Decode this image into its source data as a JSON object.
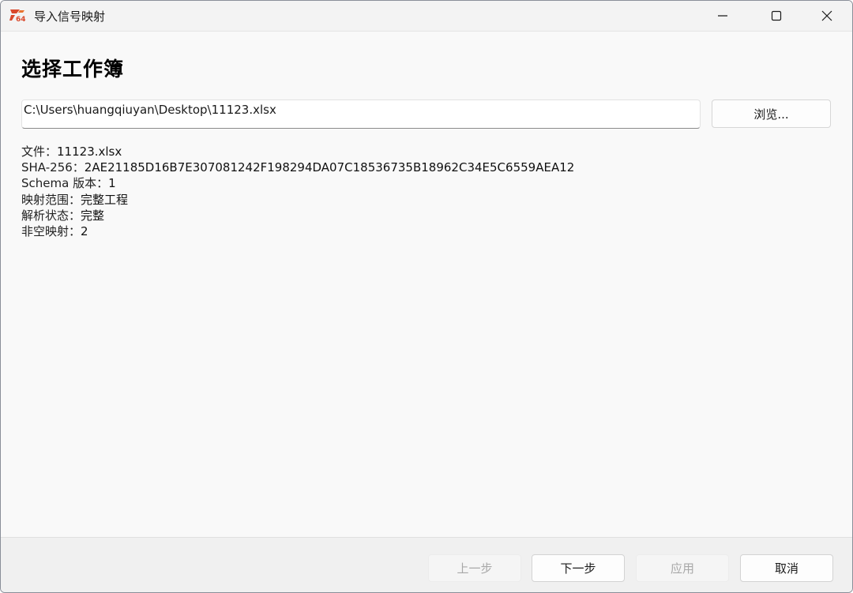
{
  "window": {
    "title": "导入信号映射",
    "icon": "app-logo-icon",
    "controls": {
      "minimize": "minimize-icon",
      "maximize": "maximize-icon",
      "close": "close-icon"
    }
  },
  "main": {
    "heading": "选择工作簿",
    "path_value": "C:\\Users\\huangqiuyan\\Desktop\\11123.xlsx",
    "browse_label": "浏览...",
    "info": [
      {
        "label": "文件：",
        "value": "11123.xlsx"
      },
      {
        "label": "SHA-256：",
        "value": "2AE21185D16B7E307081242F198294DA07C18536735B18962C34E5C6559AEA12"
      },
      {
        "label": "Schema 版本：",
        "value": "1"
      },
      {
        "label": "映射范围：",
        "value": "完整工程"
      },
      {
        "label": "解析状态：",
        "value": "完整"
      },
      {
        "label": "非空映射：",
        "value": "2"
      }
    ]
  },
  "footer": {
    "prev_label": "上一步",
    "next_label": "下一步",
    "apply_label": "应用",
    "cancel_label": "取消"
  },
  "colors": {
    "disabled_text": "#a8a8a8",
    "footer_bg": "#f0f0f0",
    "logo_accent": "#d9482b"
  }
}
